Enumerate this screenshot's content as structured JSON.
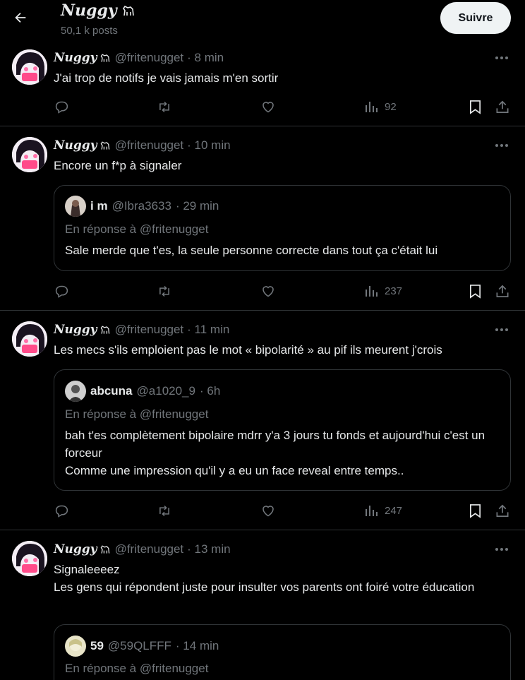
{
  "header": {
    "name": "Nuggy",
    "post_count": "50,1 k posts",
    "follow_label": "Suivre"
  },
  "tweets": [
    {
      "name": "Nuggy",
      "handle": "@fritenugget",
      "time": "· 8 min",
      "text": "J'ai trop de notifs je vais jamais m'en sortir",
      "views": "92"
    },
    {
      "name": "Nuggy",
      "handle": "@fritenugget",
      "time": "· 10 min",
      "text": "Encore un f*p à signaler",
      "views": "237",
      "quote": {
        "name": "i m",
        "handle": "@Ibra3633",
        "time": "· 29 min",
        "reply_to": "En réponse à @fritenugget",
        "text": "Sale merde que t'es, la seule personne correcte dans tout ça c'était lui"
      }
    },
    {
      "name": "Nuggy",
      "handle": "@fritenugget",
      "time": "· 11 min",
      "text": "Les mecs s'ils emploient pas le mot « bipolarité » au pif ils meurent j'crois",
      "views": "247",
      "quote": {
        "name": "abcuna",
        "handle": "@a1020_9",
        "time": "· 6h",
        "reply_to": "En réponse à @fritenugget",
        "text": "bah t'es complètement bipolaire mdrr y'a 3 jours tu fonds et aujourd'hui c'est un forceur\nComme une impression qu'il y a eu un face reveal entre temps.."
      }
    },
    {
      "name": "Nuggy",
      "handle": "@fritenugget",
      "time": "· 13 min",
      "text": "Signaleeeez\nLes gens qui répondent juste pour insulter vos parents ont foiré votre éducation",
      "quote": {
        "name": "59",
        "handle": "@59QLFFF",
        "time": "· 14 min",
        "reply_to": "En réponse à @fritenugget"
      }
    }
  ],
  "icons": {
    "back": "arrow-left-icon",
    "name_badge": "dog-emoji-icon",
    "more": "more-dots-icon",
    "reply": "reply-icon",
    "repost": "repost-icon",
    "like": "like-icon",
    "views": "views-icon",
    "bookmark": "bookmark-icon",
    "share": "share-icon"
  },
  "colors": {
    "background": "#000000",
    "text": "#e7e9ea",
    "muted": "#71767b",
    "border": "#2f3336",
    "follow_bg": "#eff3f4"
  }
}
